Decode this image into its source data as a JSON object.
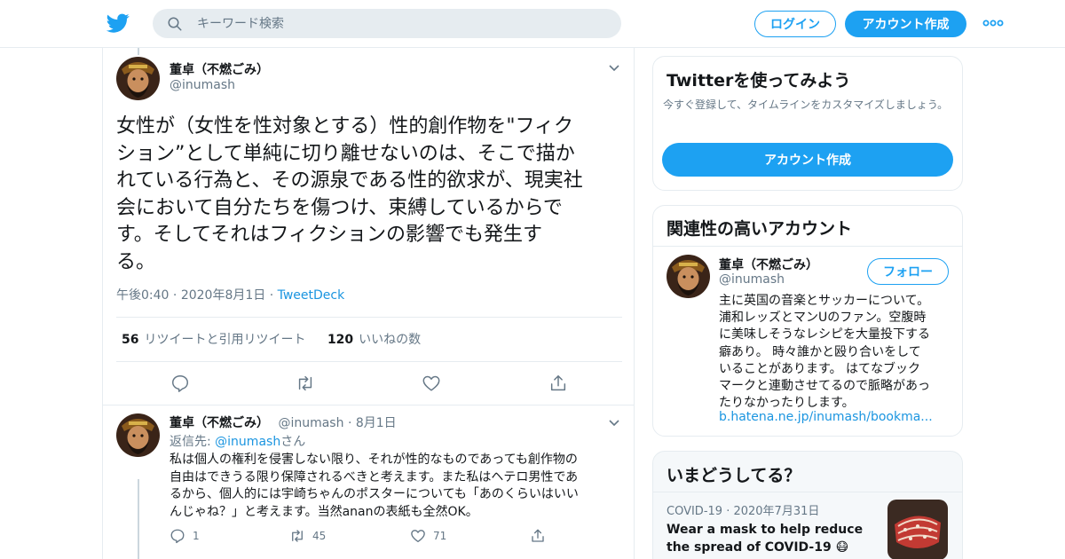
{
  "header": {
    "search_placeholder": "キーワード検索",
    "login_label": "ログイン",
    "signup_label": "アカウント作成"
  },
  "tweet": {
    "name": "董卓（不燃ごみ）",
    "handle": "@inumash",
    "text": "女性が（女性を性対象とする）性的創作物を\"フィク\nション”として単純に切り離せないのは、そこで描か\nれている行為と、その源泉である性的欲求が、現実社\n会において自分たちを傷つけ、束縛しているからで\nす。そしてそれはフィクションの影響でも発生す\nる。",
    "time": "午後0:40",
    "date": "2020年8月1日",
    "source": "TweetDeck",
    "retweet_count": "56",
    "retweet_label": "リツイートと引用リツイート",
    "like_count": "120",
    "like_label": "いいねの数"
  },
  "reply": {
    "name": "董卓（不燃ごみ）",
    "handle": "@inumash",
    "date": "8月1日",
    "reply_prefix": "返信先: ",
    "reply_handle": "@inumash",
    "reply_suffix": "さん",
    "text": "私は個人の権利を侵害しない限り、それが性的なものであっても創作物の\n自由はできうる限り保障されるべきと考えます。また私はヘテロ男性であ\nるから、個人的には宇崎ちゃんのポスターについても「あのくらいはいい\nんじゃね？」と考えます。当然ananの表紙も全然OK。",
    "replies": "1",
    "retweets": "45",
    "likes": "71"
  },
  "signup_card": {
    "title": "Twitterを使ってみよう",
    "subtitle": "今すぐ登録して、タイムラインをカスタマイズしましょう。",
    "button": "アカウント作成"
  },
  "related_card": {
    "title": "関連性の高いアカウント",
    "name": "董卓（不燃ごみ）",
    "handle": "@inumash",
    "follow_label": "フォロー",
    "bio": "主に英国の音楽とサッカーについて。\n浦和レッズとマンUのファン。空腹時\nに美味しそうなレシピを大量投下する\n癖あり。 時々誰かと殴り合いをして\nいることがあります。 はてなブック\nマークと連動させてるので脈略があっ\nたりなかったりします。",
    "link": "b.hatena.ne.jp/inumash/bookma..."
  },
  "trends_card": {
    "title": "いまどうしてる？",
    "category": "COVID-19",
    "date": "2020年7月31日",
    "headline": "Wear a mask to help reduce the spread of COVID-19 😷"
  },
  "colors": {
    "accent": "#1da1f2",
    "link": "#1b95e0",
    "text": "#14171a",
    "muted": "#657786",
    "border": "#e6ecf0"
  }
}
